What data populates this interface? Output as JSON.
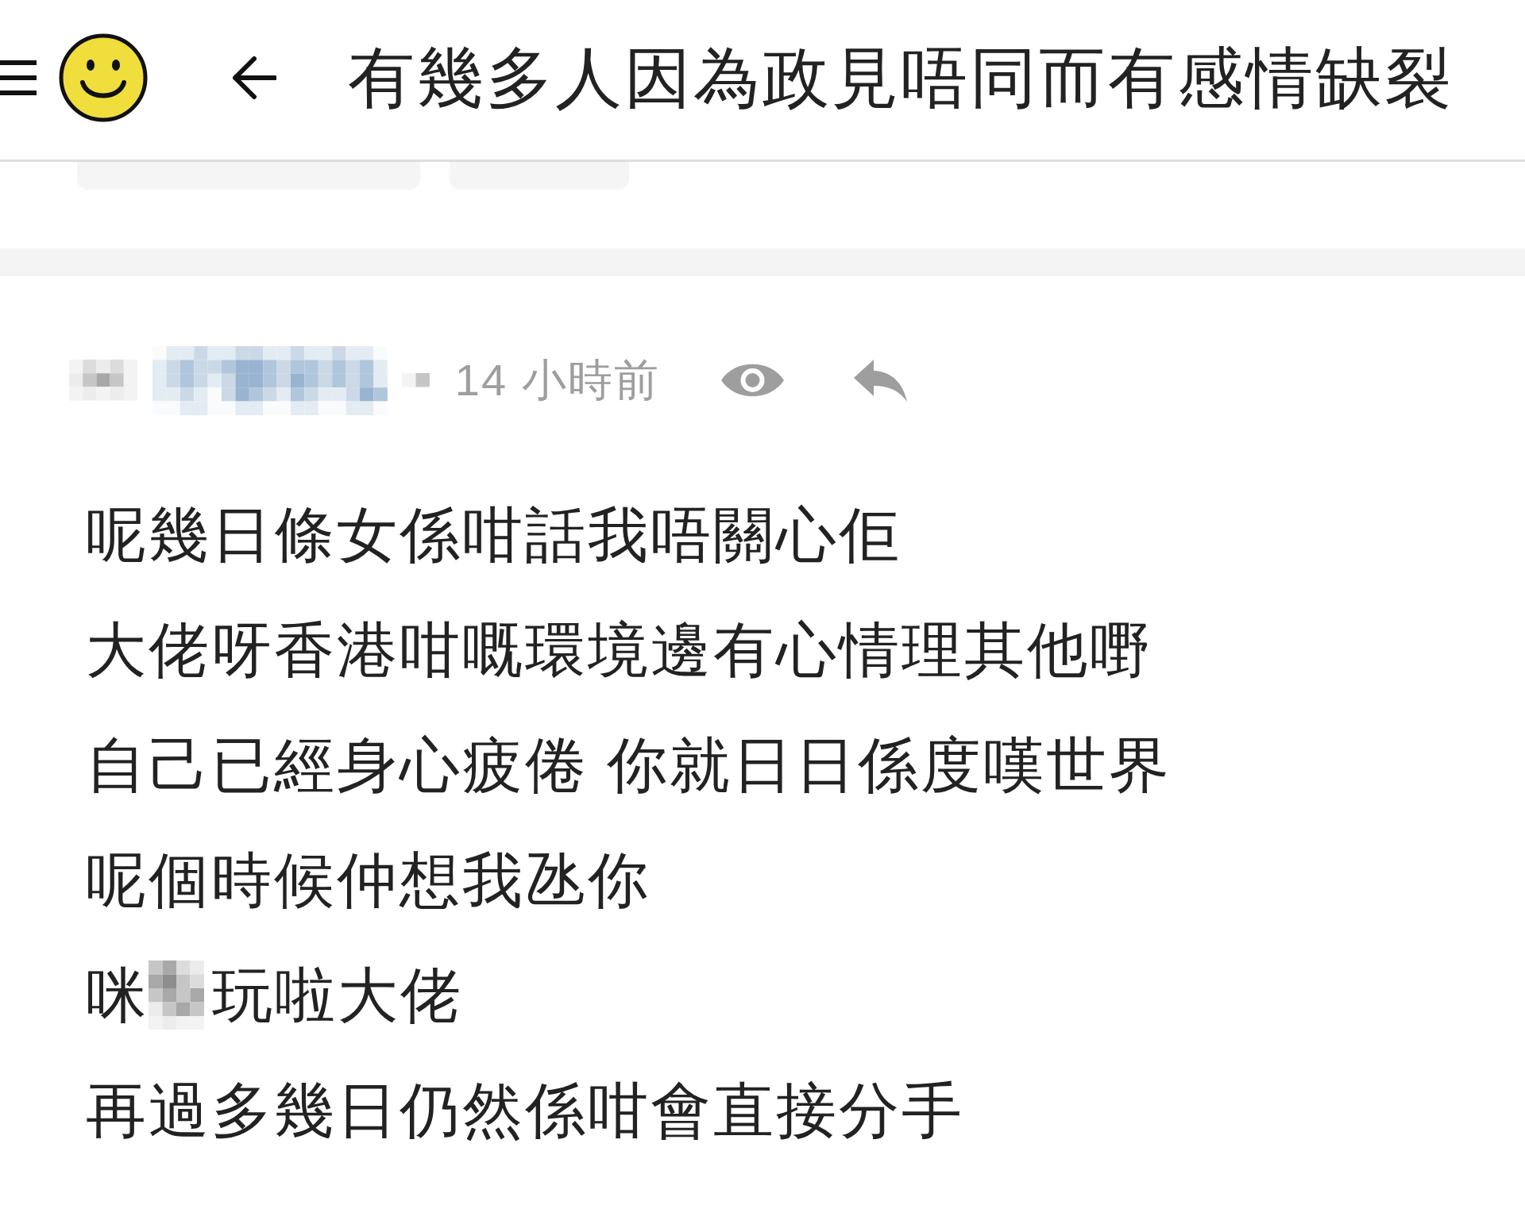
{
  "header": {
    "title": "有幾多人因為政見唔同而有感情缺裂"
  },
  "post": {
    "time": "14 小時前",
    "lines": [
      {
        "kind": "text",
        "text": "呢幾日條女係咁話我唔關心佢"
      },
      {
        "kind": "text",
        "text": "大佬呀香港咁嘅環境邊有心情理其他嘢"
      },
      {
        "kind": "text",
        "text": "自己已經身心疲倦 你就日日係度嘆世界"
      },
      {
        "kind": "text",
        "text": "呢個時候仲想我氹你"
      },
      {
        "kind": "censored",
        "before": "咪",
        "after": "玩啦大佬"
      },
      {
        "kind": "text",
        "text": "再過多幾日仍然係咁會直接分手"
      }
    ]
  }
}
